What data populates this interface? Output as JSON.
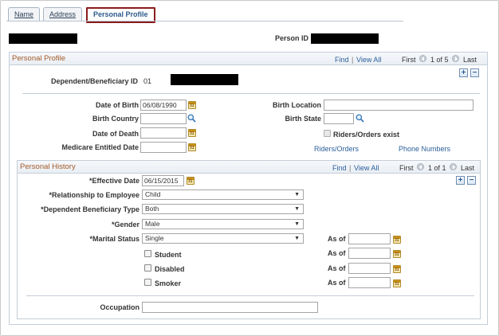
{
  "tabs": [
    {
      "label": "Name"
    },
    {
      "label": "Address"
    },
    {
      "label": "Personal Profile"
    }
  ],
  "header": {
    "person_id_label": "Person ID"
  },
  "personal_profile": {
    "title": "Personal Profile",
    "find": "Find",
    "separator": "|",
    "view_all": "View All",
    "first": "First",
    "pager": "1 of 5",
    "last": "Last",
    "add": "+",
    "remove": "−",
    "dependent_label": "Dependent/Beneficiary ID",
    "dependent_value": "01",
    "date_of_birth_label": "Date of Birth",
    "date_of_birth_value": "06/08/1990",
    "birth_country_label": "Birth Country",
    "birth_country_value": "",
    "date_of_death_label": "Date of Death",
    "date_of_death_value": "",
    "medicare_label": "Medicare Entitled Date",
    "medicare_value": "",
    "birth_location_label": "Birth Location",
    "birth_location_value": "",
    "birth_state_label": "Birth State",
    "birth_state_value": "",
    "riders_exist_label": "Riders/Orders exist",
    "riders_link": "Riders/Orders",
    "phone_link": "Phone Numbers"
  },
  "personal_history": {
    "title": "Personal History",
    "find": "Find",
    "separator": "|",
    "view_all": "View All",
    "first": "First",
    "pager": "1 of 1",
    "last": "Last",
    "add": "+",
    "remove": "−",
    "effective_date_label": "*Effective Date",
    "effective_date_value": "06/15/2015",
    "relationship_label": "*Relationship to Employee",
    "relationship_value": "Child",
    "dep_ben_type_label": "*Dependent Beneficiary Type",
    "dep_ben_type_value": "Both",
    "gender_label": "*Gender",
    "gender_value": "Male",
    "marital_label": "*Marital Status",
    "marital_value": "Single",
    "student_label": "Student",
    "disabled_label": "Disabled",
    "smoker_label": "Smoker",
    "as_of_label": "As of",
    "occupation_label": "Occupation",
    "occupation_value": ""
  },
  "colors": {
    "section_title": "#a45a2a",
    "link": "#2b5e9a",
    "active_tab_border": "#8a1c1c"
  },
  "icons": [
    "calendar-icon",
    "lookup-magnifier-icon",
    "previous-arrow-icon",
    "next-arrow-icon",
    "add-row-icon",
    "delete-row-icon",
    "dropdown-arrow-icon"
  ]
}
